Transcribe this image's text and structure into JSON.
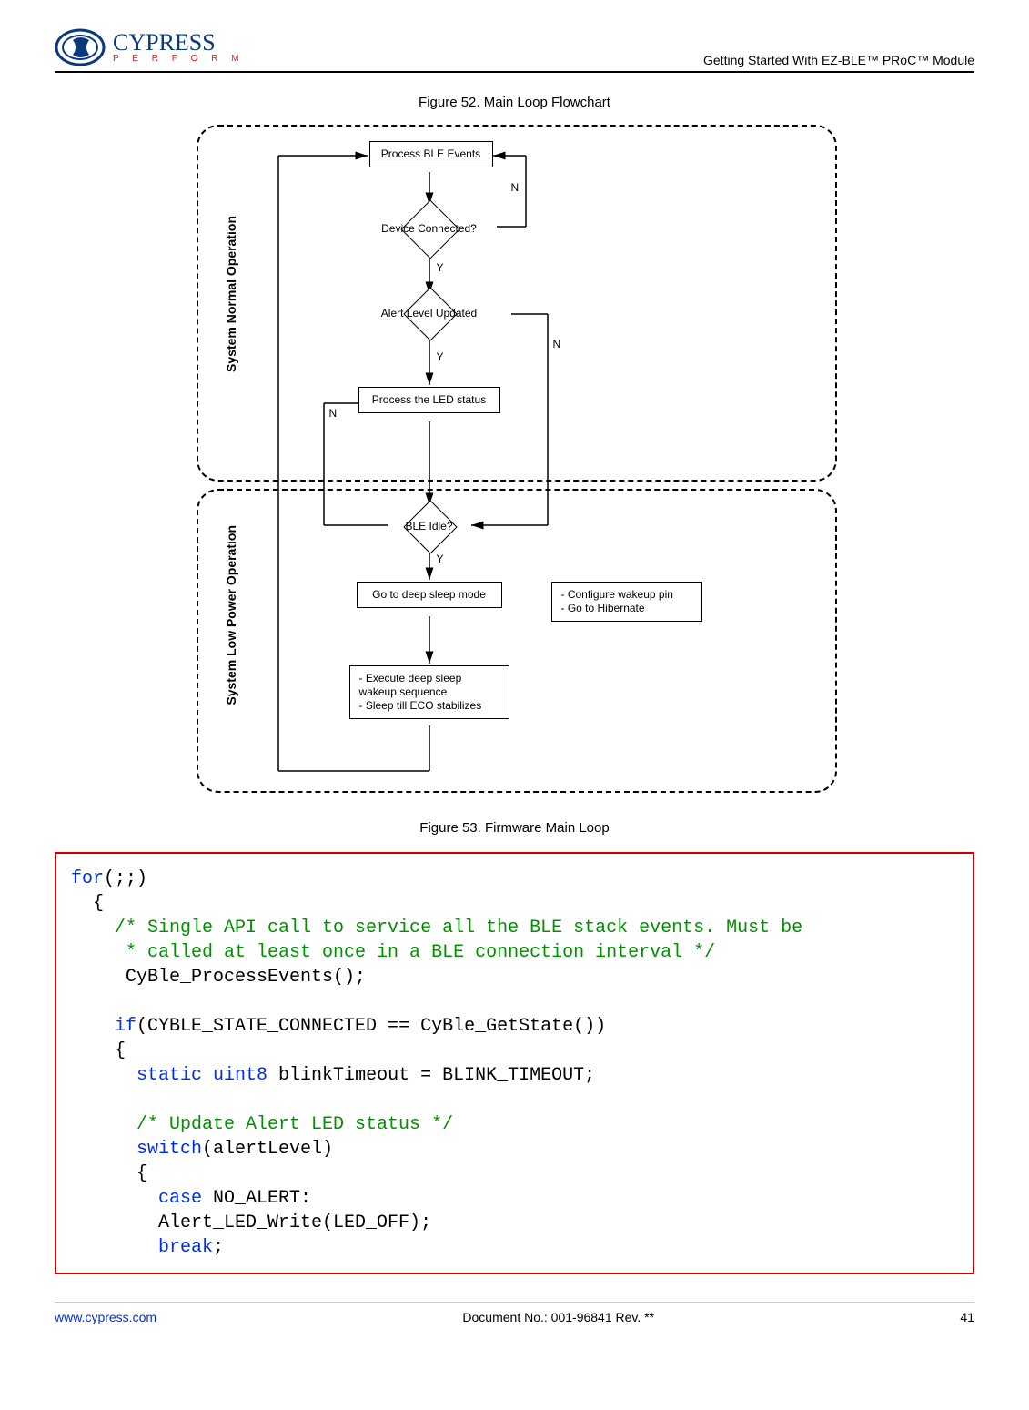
{
  "header": {
    "logo_main": "CYPRESS",
    "logo_sub": "P E R F O R M",
    "right": "Getting Started With EZ-BLE™ PRoC™ Module"
  },
  "fig52": {
    "caption": "Figure 52. Main Loop Flowchart",
    "group1_label": "System Normal Operation",
    "group2_label": "System Low Power Operation",
    "nodes": {
      "process_ble": "Process BLE Events",
      "device_connected": "Device Connected?",
      "alert_updated": "Alert Level Updated",
      "process_led": "Process the LED status",
      "ble_idle": "BLE Idle?",
      "deep_sleep": "Go to deep sleep mode",
      "wakeup_seq": "- Execute deep sleep wakeup sequence\n- Sleep till ECO stabilizes",
      "configure": "- Configure wakeup pin\n- Go to Hibernate"
    },
    "edges": {
      "Y": "Y",
      "N": "N"
    }
  },
  "fig53": {
    "caption": "Figure 53. Firmware Main Loop"
  },
  "code": {
    "l01a": "for",
    "l01b": "(;;)",
    "l02": "  {",
    "l03": "    /* Single API call to service all the BLE stack events. Must be",
    "l04": "     * called at least once in a BLE connection interval */",
    "l05": "     CyBle_ProcessEvents();",
    "l06": "",
    "l07a": "    if",
    "l07b": "(CYBLE_STATE_CONNECTED == CyBle_GetState())",
    "l08": "    {",
    "l09a": "      static",
    "l09b": " uint8",
    "l09c": " blinkTimeout = BLINK_TIMEOUT;",
    "l10": "",
    "l11": "      /* Update Alert LED status */",
    "l12a": "      switch",
    "l12b": "(alertLevel)",
    "l13": "      {",
    "l14a": "        case",
    "l14b": " NO_ALERT:",
    "l15": "        Alert_LED_Write(LED_OFF);",
    "l16a": "        break",
    "l16b": ";"
  },
  "footer": {
    "link": "www.cypress.com",
    "doc": "Document No.: 001-96841 Rev. **",
    "page": "41"
  }
}
